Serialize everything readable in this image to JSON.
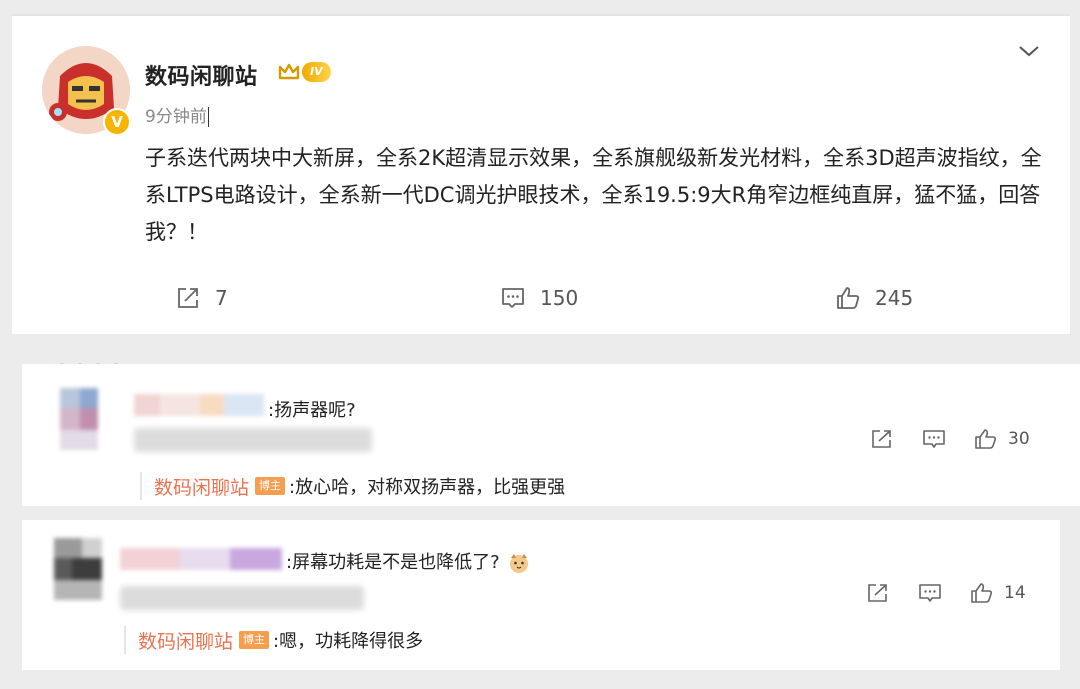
{
  "post": {
    "author": "数码闲聊站",
    "level_badge": "IV",
    "verified_badge": "V",
    "time": "9分钟前",
    "text": "子系迭代两块中大新屏，全系2K超清显示效果，全系旗舰级新发光材料，全系3D超声波指纹，全系LTPS电路设计，全系新一代DC调光护眼技术，全系19.5:9大R角窄边框纯直屏，猛不猛，回答我？！",
    "actions": {
      "repost_count": "7",
      "comment_count": "150",
      "like_count": "245"
    },
    "icons": [
      "avatar-ironman",
      "crown-icon",
      "chevron-down-icon",
      "share-icon",
      "comment-icon",
      "like-icon"
    ]
  },
  "comments": [
    {
      "text": ":扬声器呢?",
      "like_count": "30",
      "reply": {
        "name": "数码闲聊站",
        "tag": "博主",
        "text": ":放心哈，对称双扬声器，比强更强"
      }
    },
    {
      "text": ":屏幕功耗是不是也降低了?",
      "emoji": "cat-emoji",
      "like_count": "14",
      "reply": {
        "name": "数码闲聊站",
        "tag": "博主",
        "text": ":嗯，功耗降得很多"
      }
    }
  ],
  "colors": {
    "accent_orange": "#eb7350",
    "verified_gold": "#f7b500",
    "background": "#ececec"
  }
}
